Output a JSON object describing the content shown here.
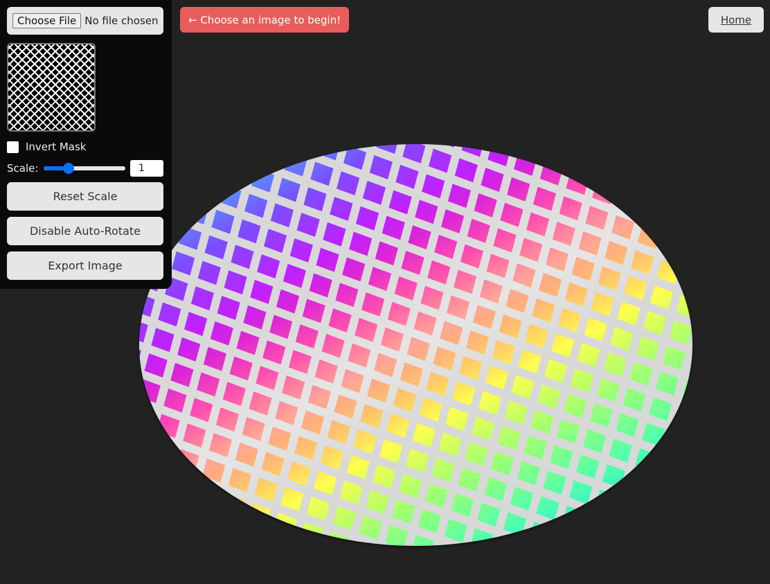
{
  "panel": {
    "file_button": "Choose File",
    "file_status": "No file chosen",
    "invert_mask_label": "Invert Mask",
    "invert_mask_checked": false,
    "scale_label": "Scale:",
    "scale_slider_fraction": 0.3,
    "scale_value": "1",
    "reset_scale": "Reset Scale",
    "disable_auto_rotate": "Disable Auto-Rotate",
    "export_image": "Export Image"
  },
  "hint": "← Choose an image to begin!",
  "home": "Home",
  "colors": {
    "accent": "#0b6ff5",
    "hint_bg": "#e95c5c",
    "background": "#222222"
  }
}
